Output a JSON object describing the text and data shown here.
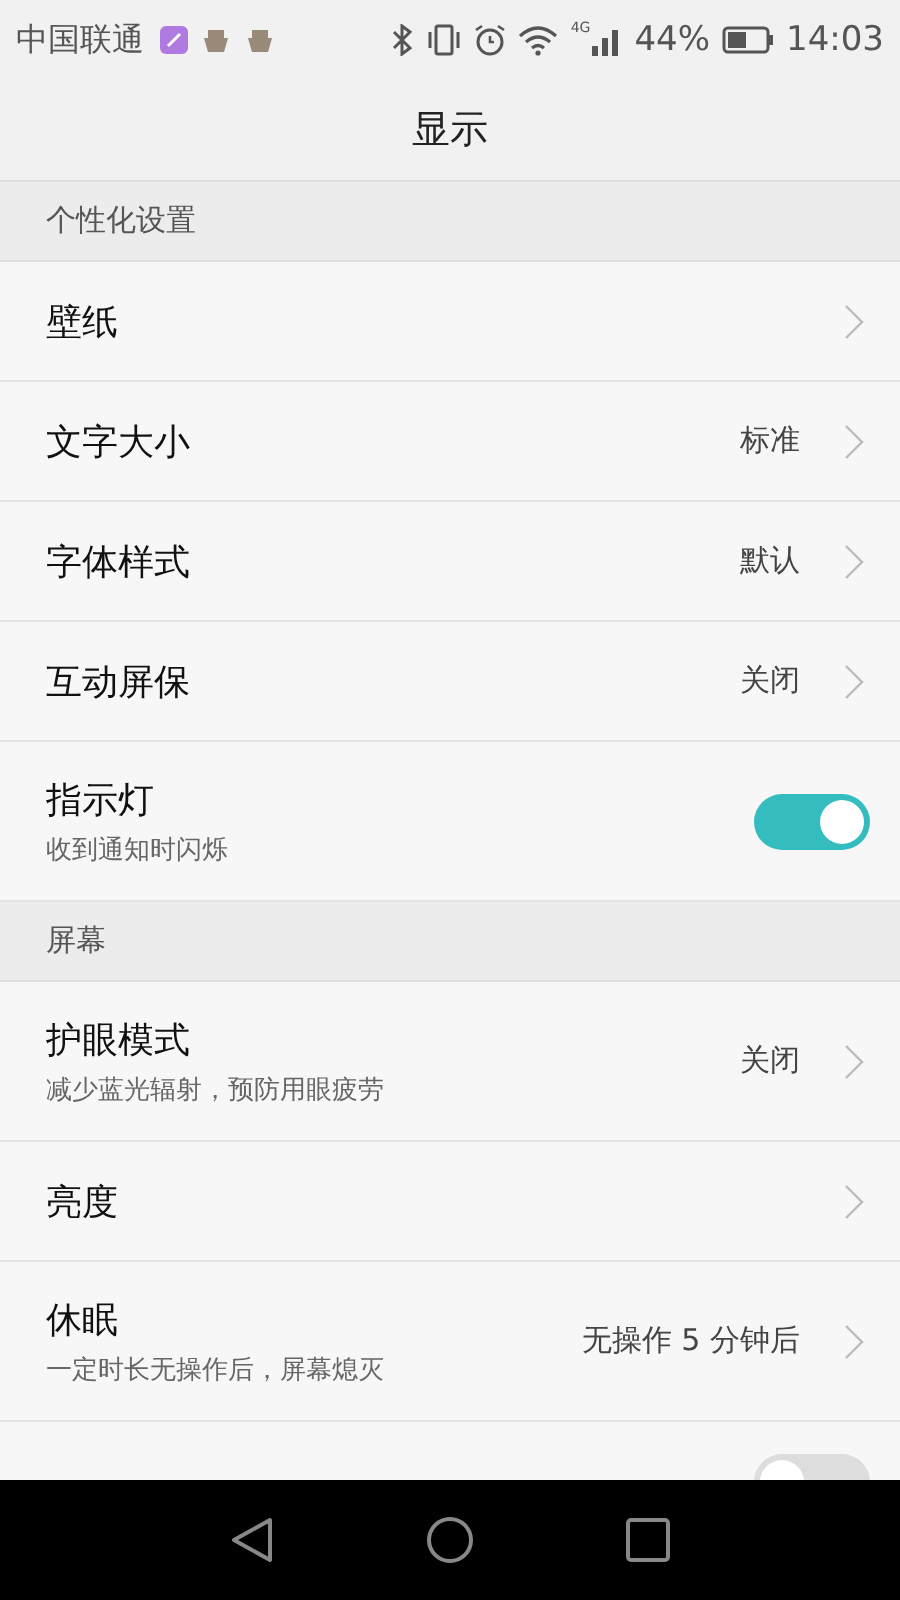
{
  "status_bar": {
    "carrier": "中国联通",
    "battery_percent": "44%",
    "time": "14:03",
    "network": "4G"
  },
  "title": "显示",
  "sections": [
    {
      "header": "个性化设置",
      "items": [
        {
          "kind": "nav",
          "label": "壁纸"
        },
        {
          "kind": "nav",
          "label": "文字大小",
          "value": "标准"
        },
        {
          "kind": "nav",
          "label": "字体样式",
          "value": "默认"
        },
        {
          "kind": "nav",
          "label": "互动屏保",
          "value": "关闭"
        },
        {
          "kind": "toggle",
          "label": "指示灯",
          "subtitle": "收到通知时闪烁",
          "on": true
        }
      ]
    },
    {
      "header": "屏幕",
      "items": [
        {
          "kind": "nav",
          "label": "护眼模式",
          "subtitle": "减少蓝光辐射，预防用眼疲劳",
          "value": "关闭"
        },
        {
          "kind": "nav",
          "label": "亮度"
        },
        {
          "kind": "nav",
          "label": "休眠",
          "subtitle": "一定时长无操作后，屏幕熄灭",
          "value": "无操作 5 分钟后"
        },
        {
          "kind": "toggle",
          "on": false
        }
      ]
    }
  ]
}
